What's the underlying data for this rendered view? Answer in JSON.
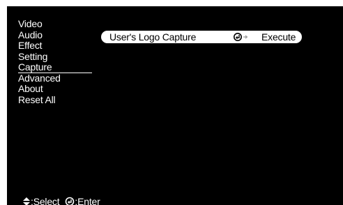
{
  "menu": {
    "items": [
      {
        "label": "Video"
      },
      {
        "label": "Audio"
      },
      {
        "label": "Effect"
      },
      {
        "label": "Setting"
      },
      {
        "label": "Capture",
        "selected": true
      },
      {
        "label": "Advanced"
      },
      {
        "label": "About"
      },
      {
        "label": "Reset All"
      }
    ]
  },
  "capture_panel": {
    "option_label": "User's Logo Capture",
    "action_icon": "enter-icon",
    "action_label": "Execute"
  },
  "hints": {
    "select_icon": "up-down-arrow-icon",
    "select_label": ":Select",
    "enter_icon": "enter-icon",
    "enter_label": ":Enter"
  }
}
